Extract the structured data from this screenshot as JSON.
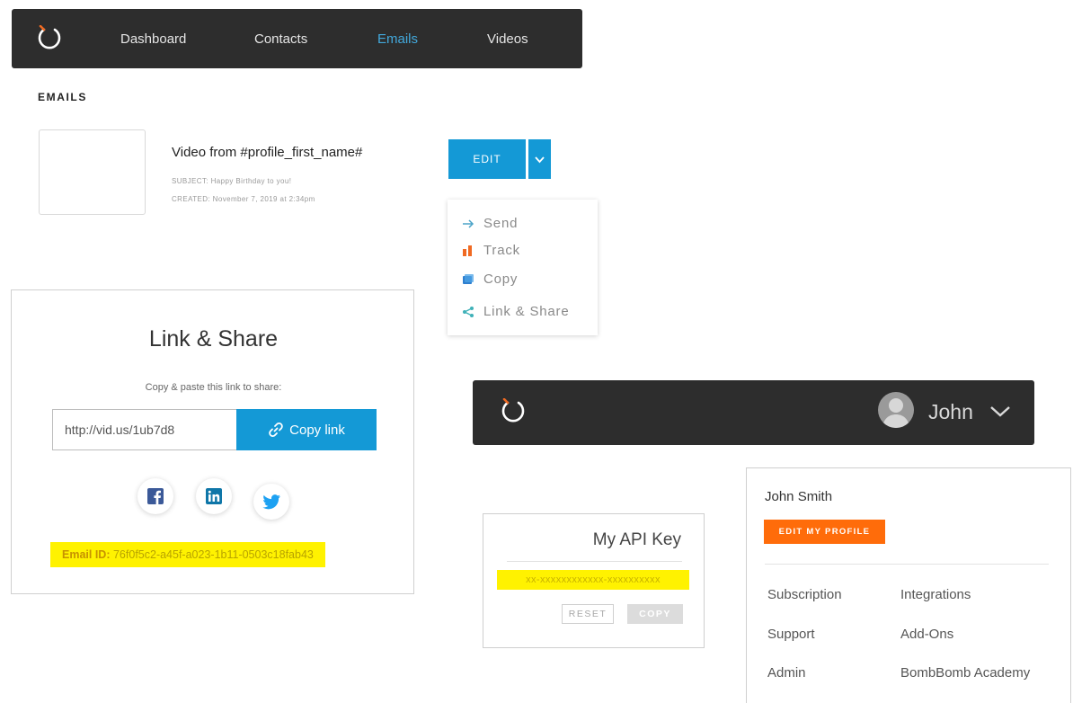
{
  "colors": {
    "nav_bg": "#2d2d2d",
    "accent_blue": "#1499d6",
    "active_link": "#42a8db",
    "highlight_yellow": "#fff200",
    "profile_orange": "#ff6c0a",
    "track_orange": "#f06a22",
    "logo_orange": "#f06a22"
  },
  "top_nav": {
    "logo_icon": "power-ring-logo",
    "links": [
      {
        "label": "Dashboard",
        "active": false
      },
      {
        "label": "Contacts",
        "active": false
      },
      {
        "label": "Emails",
        "active": true
      },
      {
        "label": "Videos",
        "active": false
      }
    ]
  },
  "emails": {
    "section_title": "EMAILS",
    "item": {
      "name": "Video from #profile_first_name#",
      "subject": "SUBJECT: Happy Birthday to you!",
      "created": "CREATED: November 7, 2019 at 2:34pm"
    },
    "edit_label": "EDIT",
    "menu": [
      {
        "label": "Send",
        "icon": "arrow-right-icon"
      },
      {
        "label": "Track",
        "icon": "bar-chart-icon"
      },
      {
        "label": "Copy",
        "icon": "copy-icon"
      },
      {
        "label": "Link & Share",
        "icon": "share-icon"
      }
    ]
  },
  "share": {
    "title": "Link & Share",
    "subtitle": "Copy & paste this link to share:",
    "link_value": "http://vid.us/1ub7d8",
    "copy_label": "Copy link",
    "social": [
      "facebook-icon",
      "linkedin-icon",
      "twitter-icon"
    ],
    "email_id_label": "Email ID:",
    "email_id_value": "76f0f5c2-a45f-a023-1b11-0503c18fab43"
  },
  "user_nav": {
    "user_name": "John"
  },
  "api": {
    "title": "My API Key",
    "key": "xx-xxxxxxxxxxxx-xxxxxxxxxx",
    "reset_label": "RESET",
    "copy_label": "COPY"
  },
  "profile": {
    "full_name": "John Smith",
    "edit_label": "EDIT MY PROFILE",
    "menu_left": [
      "Subscription",
      "Support",
      "Admin"
    ],
    "menu_right": [
      "Integrations",
      "Add-Ons",
      "BombBomb Academy"
    ]
  }
}
